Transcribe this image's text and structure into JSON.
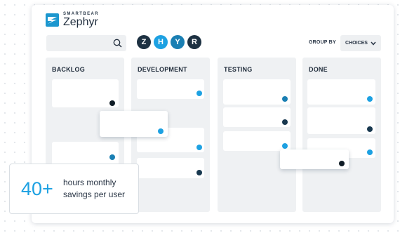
{
  "brand": {
    "company": "SMARTBEAR",
    "product": "Zephyr",
    "accent": "#1c97cf"
  },
  "search": {
    "placeholder": "",
    "icon": "search-icon"
  },
  "avatars": [
    {
      "letter": "Z",
      "color": "#1d3142"
    },
    {
      "letter": "H",
      "color": "#1da1e2"
    },
    {
      "letter": "Y",
      "color": "#1a7fb3"
    },
    {
      "letter": "R",
      "color": "#1d3142"
    }
  ],
  "group_by": {
    "label": "GROUP BY",
    "value": "CHOICES"
  },
  "columns": [
    {
      "title": "BACKLOG"
    },
    {
      "title": "DEVELOPMENT"
    },
    {
      "title": "TESTING"
    },
    {
      "title": "DONE"
    }
  ],
  "stats": {
    "value": "40+",
    "line1": "hours monthly",
    "line2": "savings per user"
  },
  "colors": {
    "dot_light": "#1da1e2",
    "dot_mid": "#1a7fb3",
    "dot_dark": "#18384f",
    "dot_black": "#0f1c26"
  }
}
